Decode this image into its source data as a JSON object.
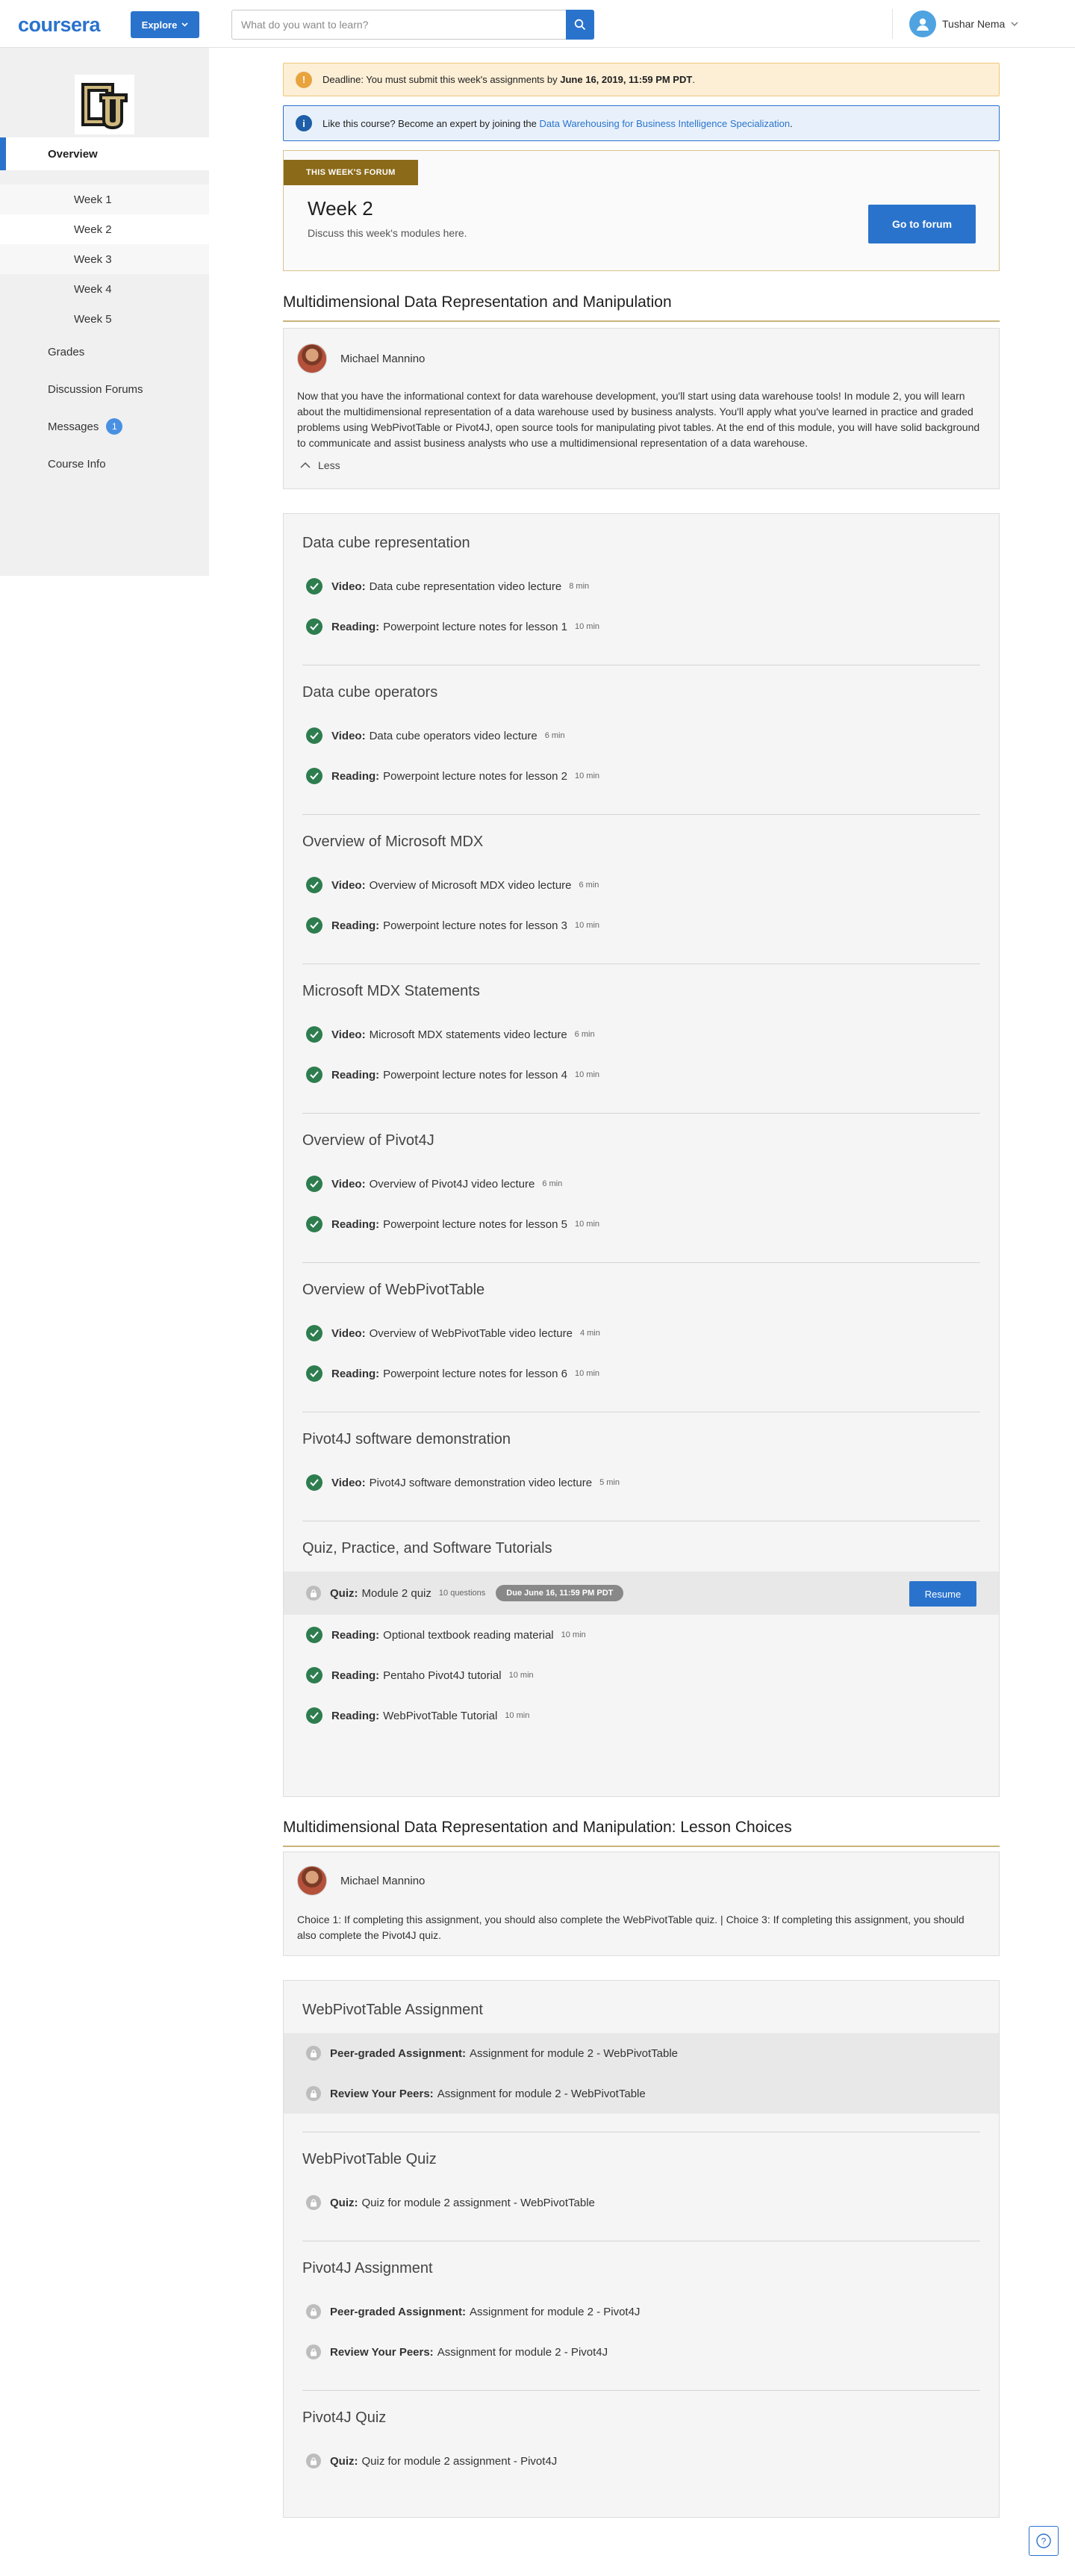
{
  "header": {
    "logo": "coursera",
    "explore_label": "Explore",
    "search_placeholder": "What do you want to learn?",
    "user_name": "Tushar Nema"
  },
  "sidebar": {
    "items": [
      {
        "label": "Overview"
      },
      {
        "label": "Week 1"
      },
      {
        "label": "Week 2"
      },
      {
        "label": "Week 3"
      },
      {
        "label": "Week 4"
      },
      {
        "label": "Week 5"
      },
      {
        "label": "Grades"
      },
      {
        "label": "Discussion Forums"
      },
      {
        "label": "Messages"
      },
      {
        "label": "Course Info"
      }
    ],
    "messages_count": "1"
  },
  "alerts": {
    "deadline_prefix": "Deadline: You must submit this week's assignments by ",
    "deadline_date": "June 16, 2019, 11:59 PM PDT",
    "deadline_suffix": ".",
    "info_prefix": "Like this course? Become an expert by joining the ",
    "info_link": "Data Warehousing for Business Intelligence Specialization",
    "info_suffix": "."
  },
  "forum": {
    "tag": "THIS WEEK'S FORUM",
    "title": "Week 2",
    "subtitle": "Discuss this week's modules here.",
    "button": "Go to forum"
  },
  "module1": {
    "title": "Multidimensional Data Representation and Manipulation",
    "instructor": "Michael Mannino",
    "description": "Now that you have the informational context for data warehouse development, you'll start using data warehouse tools! In module 2, you will learn about the multidimensional representation of a data warehouse used by business analysts. You'll apply what you've learned in practice and graded problems using WebPivotTable or Pivot4J, open source tools for manipulating pivot tables. At the end of this module, you will have solid background to communicate and assist business analysts who use a multidimensional representation of a data warehouse.",
    "less_label": "Less",
    "lessons": [
      {
        "title": "Data cube representation",
        "items": [
          {
            "type": "Video:",
            "name": "Data cube representation video lecture",
            "duration": "8 min"
          },
          {
            "type": "Reading:",
            "name": "Powerpoint lecture notes for lesson 1",
            "duration": "10 min"
          }
        ]
      },
      {
        "title": "Data cube operators",
        "items": [
          {
            "type": "Video:",
            "name": "Data cube operators video lecture",
            "duration": "6 min"
          },
          {
            "type": "Reading:",
            "name": "Powerpoint lecture notes for lesson 2",
            "duration": "10 min"
          }
        ]
      },
      {
        "title": "Overview of Microsoft MDX",
        "items": [
          {
            "type": "Video:",
            "name": "Overview of Microsoft MDX video lecture",
            "duration": "6 min"
          },
          {
            "type": "Reading:",
            "name": "Powerpoint lecture notes for lesson 3",
            "duration": "10 min"
          }
        ]
      },
      {
        "title": "Microsoft MDX Statements",
        "items": [
          {
            "type": "Video:",
            "name": "Microsoft MDX statements video lecture",
            "duration": "6 min"
          },
          {
            "type": "Reading:",
            "name": "Powerpoint lecture notes for lesson 4",
            "duration": "10 min"
          }
        ]
      },
      {
        "title": "Overview of Pivot4J",
        "items": [
          {
            "type": "Video:",
            "name": "Overview of Pivot4J video lecture",
            "duration": "6 min"
          },
          {
            "type": "Reading:",
            "name": "Powerpoint lecture notes for lesson 5",
            "duration": "10 min"
          }
        ]
      },
      {
        "title": "Overview of WebPivotTable",
        "items": [
          {
            "type": "Video:",
            "name": "Overview of WebPivotTable video lecture",
            "duration": "4 min"
          },
          {
            "type": "Reading:",
            "name": "Powerpoint lecture notes for lesson 6",
            "duration": "10 min"
          }
        ]
      },
      {
        "title": "Pivot4J software demonstration",
        "items": [
          {
            "type": "Video:",
            "name": "Pivot4J software demonstration video lecture",
            "duration": "5 min"
          }
        ]
      },
      {
        "title": "Quiz, Practice, and Software Tutorials",
        "quiz": {
          "type": "Quiz:",
          "name": "Module 2 quiz",
          "questions": "10 questions",
          "due": "Due June 16, 11:59 PM PDT",
          "button": "Resume"
        },
        "items": [
          {
            "type": "Reading:",
            "name": "Optional textbook reading material",
            "duration": "10 min"
          },
          {
            "type": "Reading:",
            "name": "Pentaho Pivot4J tutorial",
            "duration": "10 min"
          },
          {
            "type": "Reading:",
            "name": "WebPivotTable Tutorial",
            "duration": "10 min"
          }
        ]
      }
    ]
  },
  "module2": {
    "title": "Multidimensional Data Representation and Manipulation: Lesson Choices",
    "instructor": "Michael Mannino",
    "description": "Choice 1: If completing this assignment, you should also complete the WebPivotTable quiz. | Choice 3: If completing this assignment, you should also complete the Pivot4J quiz.",
    "lessons": [
      {
        "title": "WebPivotTable Assignment",
        "items": [
          {
            "type": "Peer-graded Assignment:",
            "name": "Assignment for module 2 - WebPivotTable"
          },
          {
            "type": "Review Your Peers:",
            "name": "Assignment for module 2 - WebPivotTable"
          }
        ]
      },
      {
        "title": "WebPivotTable Quiz",
        "items": [
          {
            "type": "Quiz:",
            "name": "Quiz for module 2 assignment - WebPivotTable"
          }
        ]
      },
      {
        "title": "Pivot4J Assignment",
        "items": [
          {
            "type": "Peer-graded Assignment:",
            "name": "Assignment for module 2 - Pivot4J"
          },
          {
            "type": "Review Your Peers:",
            "name": "Assignment for module 2 - Pivot4J"
          }
        ]
      },
      {
        "title": "Pivot4J Quiz",
        "items": [
          {
            "type": "Quiz:",
            "name": "Quiz for module 2 assignment - Pivot4J"
          }
        ]
      }
    ]
  }
}
